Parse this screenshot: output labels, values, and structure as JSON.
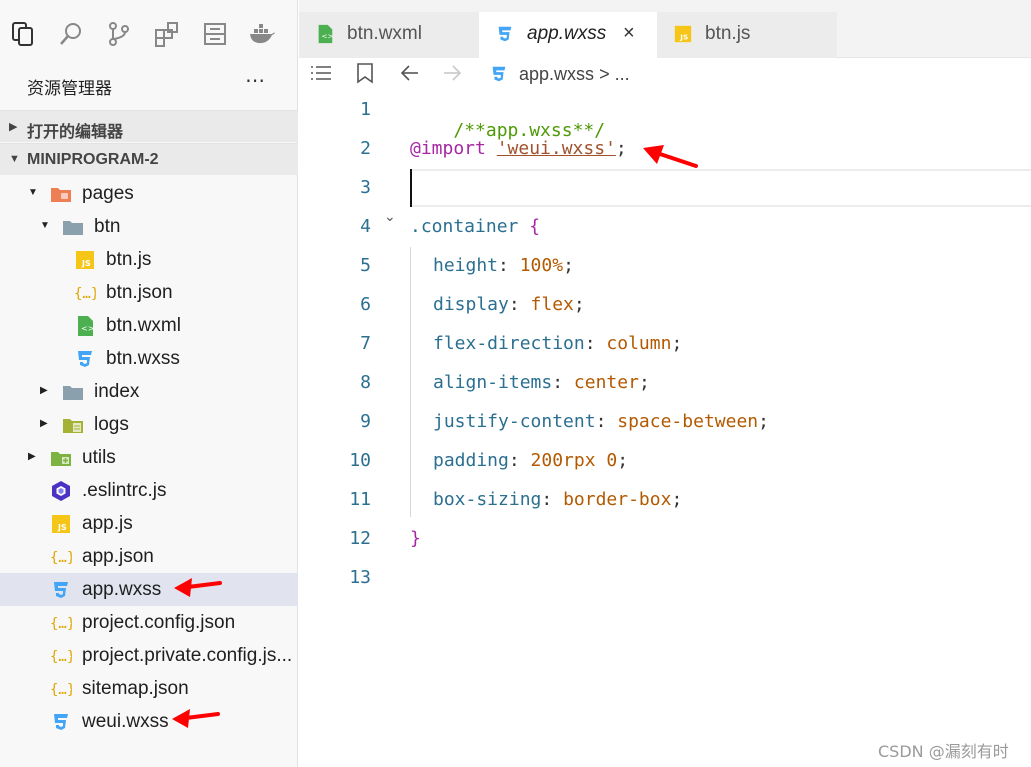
{
  "sidebar": {
    "activity_icons": [
      "files-icon",
      "search-icon",
      "source-control-icon",
      "extensions-icon",
      "storage-icon",
      "docker-icon"
    ],
    "explorer_title": "资源管理器",
    "more": "⋯",
    "sections": [
      {
        "label": "打开的编辑器",
        "caret": "▶"
      },
      {
        "label": "MINIPROGRAM-2",
        "caret": "▼"
      }
    ],
    "tree": [
      {
        "label": "pages",
        "icon": "folder-pages-icon",
        "twisty": "▼"
      },
      {
        "label": "btn",
        "icon": "folder-icon",
        "twisty": "▼"
      },
      {
        "label": "btn.js",
        "icon": "js-file-icon"
      },
      {
        "label": "btn.json",
        "icon": "json-file-icon"
      },
      {
        "label": "btn.wxml",
        "icon": "wxml-file-icon"
      },
      {
        "label": "btn.wxss",
        "icon": "css-file-icon"
      },
      {
        "label": "index",
        "icon": "folder-icon",
        "twisty": "▶"
      },
      {
        "label": "logs",
        "icon": "folder-logs-icon",
        "twisty": "▶"
      },
      {
        "label": "utils",
        "icon": "folder-utils-icon",
        "twisty": "▶"
      },
      {
        "label": ".eslintrc.js",
        "icon": "eslint-file-icon"
      },
      {
        "label": "app.js",
        "icon": "js-file-icon"
      },
      {
        "label": "app.json",
        "icon": "json-file-icon"
      },
      {
        "label": "app.wxss",
        "icon": "css-file-icon",
        "selected": true
      },
      {
        "label": "project.config.json",
        "icon": "json-file-icon"
      },
      {
        "label": "project.private.config.js...",
        "icon": "json-file-icon"
      },
      {
        "label": "sitemap.json",
        "icon": "json-file-icon"
      },
      {
        "label": "weui.wxss",
        "icon": "css-file-icon"
      }
    ]
  },
  "tabs": [
    {
      "label": "btn.wxml",
      "icon": "wxml-file-icon",
      "active": false
    },
    {
      "label": "app.wxss",
      "icon": "css-file-icon",
      "active": true,
      "close": "×"
    },
    {
      "label": "btn.js",
      "icon": "js-file-icon",
      "active": false
    }
  ],
  "breadcrumb": {
    "file": "app.wxss",
    "sep": "> ..."
  },
  "editor": {
    "line_numbers": [
      "1",
      "2",
      "3",
      "4",
      "5",
      "6",
      "7",
      "8",
      "9",
      "10",
      "11",
      "12",
      "13"
    ],
    "code": {
      "l1": "/**app.wxss**/",
      "l2_at": "@import",
      "l2_str": "'weui.wxss'",
      "l2_semi": ";",
      "l4_sel": ".container",
      "l4_brace": "{",
      "props": [
        {
          "prop": "height",
          "val": "100%"
        },
        {
          "prop": "display",
          "val": "flex"
        },
        {
          "prop": "flex-direction",
          "val": "column"
        },
        {
          "prop": "align-items",
          "val": "center"
        },
        {
          "prop": "justify-content",
          "val": "space-between"
        },
        {
          "prop": "padding",
          "val": "200rpx 0"
        },
        {
          "prop": "box-sizing",
          "val": "border-box"
        }
      ],
      "l12": "}"
    }
  },
  "colors": {
    "annotation_arrow": "#ff0000",
    "selected_row": "#e1e4ee"
  },
  "watermark": "CSDN @漏刻有时"
}
